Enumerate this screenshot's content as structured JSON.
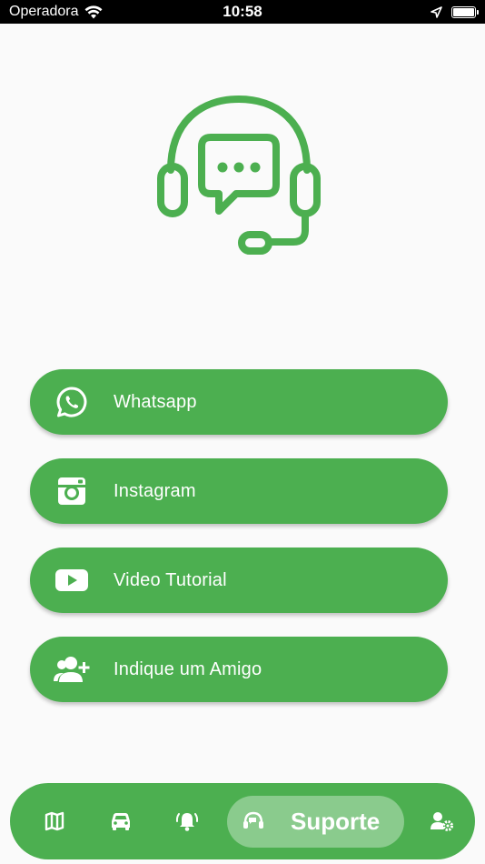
{
  "status_bar": {
    "carrier": "Operadora",
    "time": "10:58"
  },
  "hero": {
    "icon": "headset-support-icon",
    "color": "#4caf50"
  },
  "menu": {
    "items": [
      {
        "label": "Whatsapp",
        "icon": "whatsapp-icon"
      },
      {
        "label": "Instagram",
        "icon": "instagram-icon"
      },
      {
        "label": "Video Tutorial",
        "icon": "youtube-icon"
      },
      {
        "label": "Indique um Amigo",
        "icon": "add-friend-icon"
      }
    ]
  },
  "bottom_nav": {
    "items": [
      {
        "icon": "map-icon"
      },
      {
        "icon": "car-icon"
      },
      {
        "icon": "bell-icon"
      },
      {
        "icon": "support-icon",
        "label": "Suporte",
        "active": true
      },
      {
        "icon": "user-settings-icon"
      }
    ]
  },
  "colors": {
    "accent": "#4caf50",
    "background": "#fafafa",
    "active_pill": "#94cf96"
  }
}
